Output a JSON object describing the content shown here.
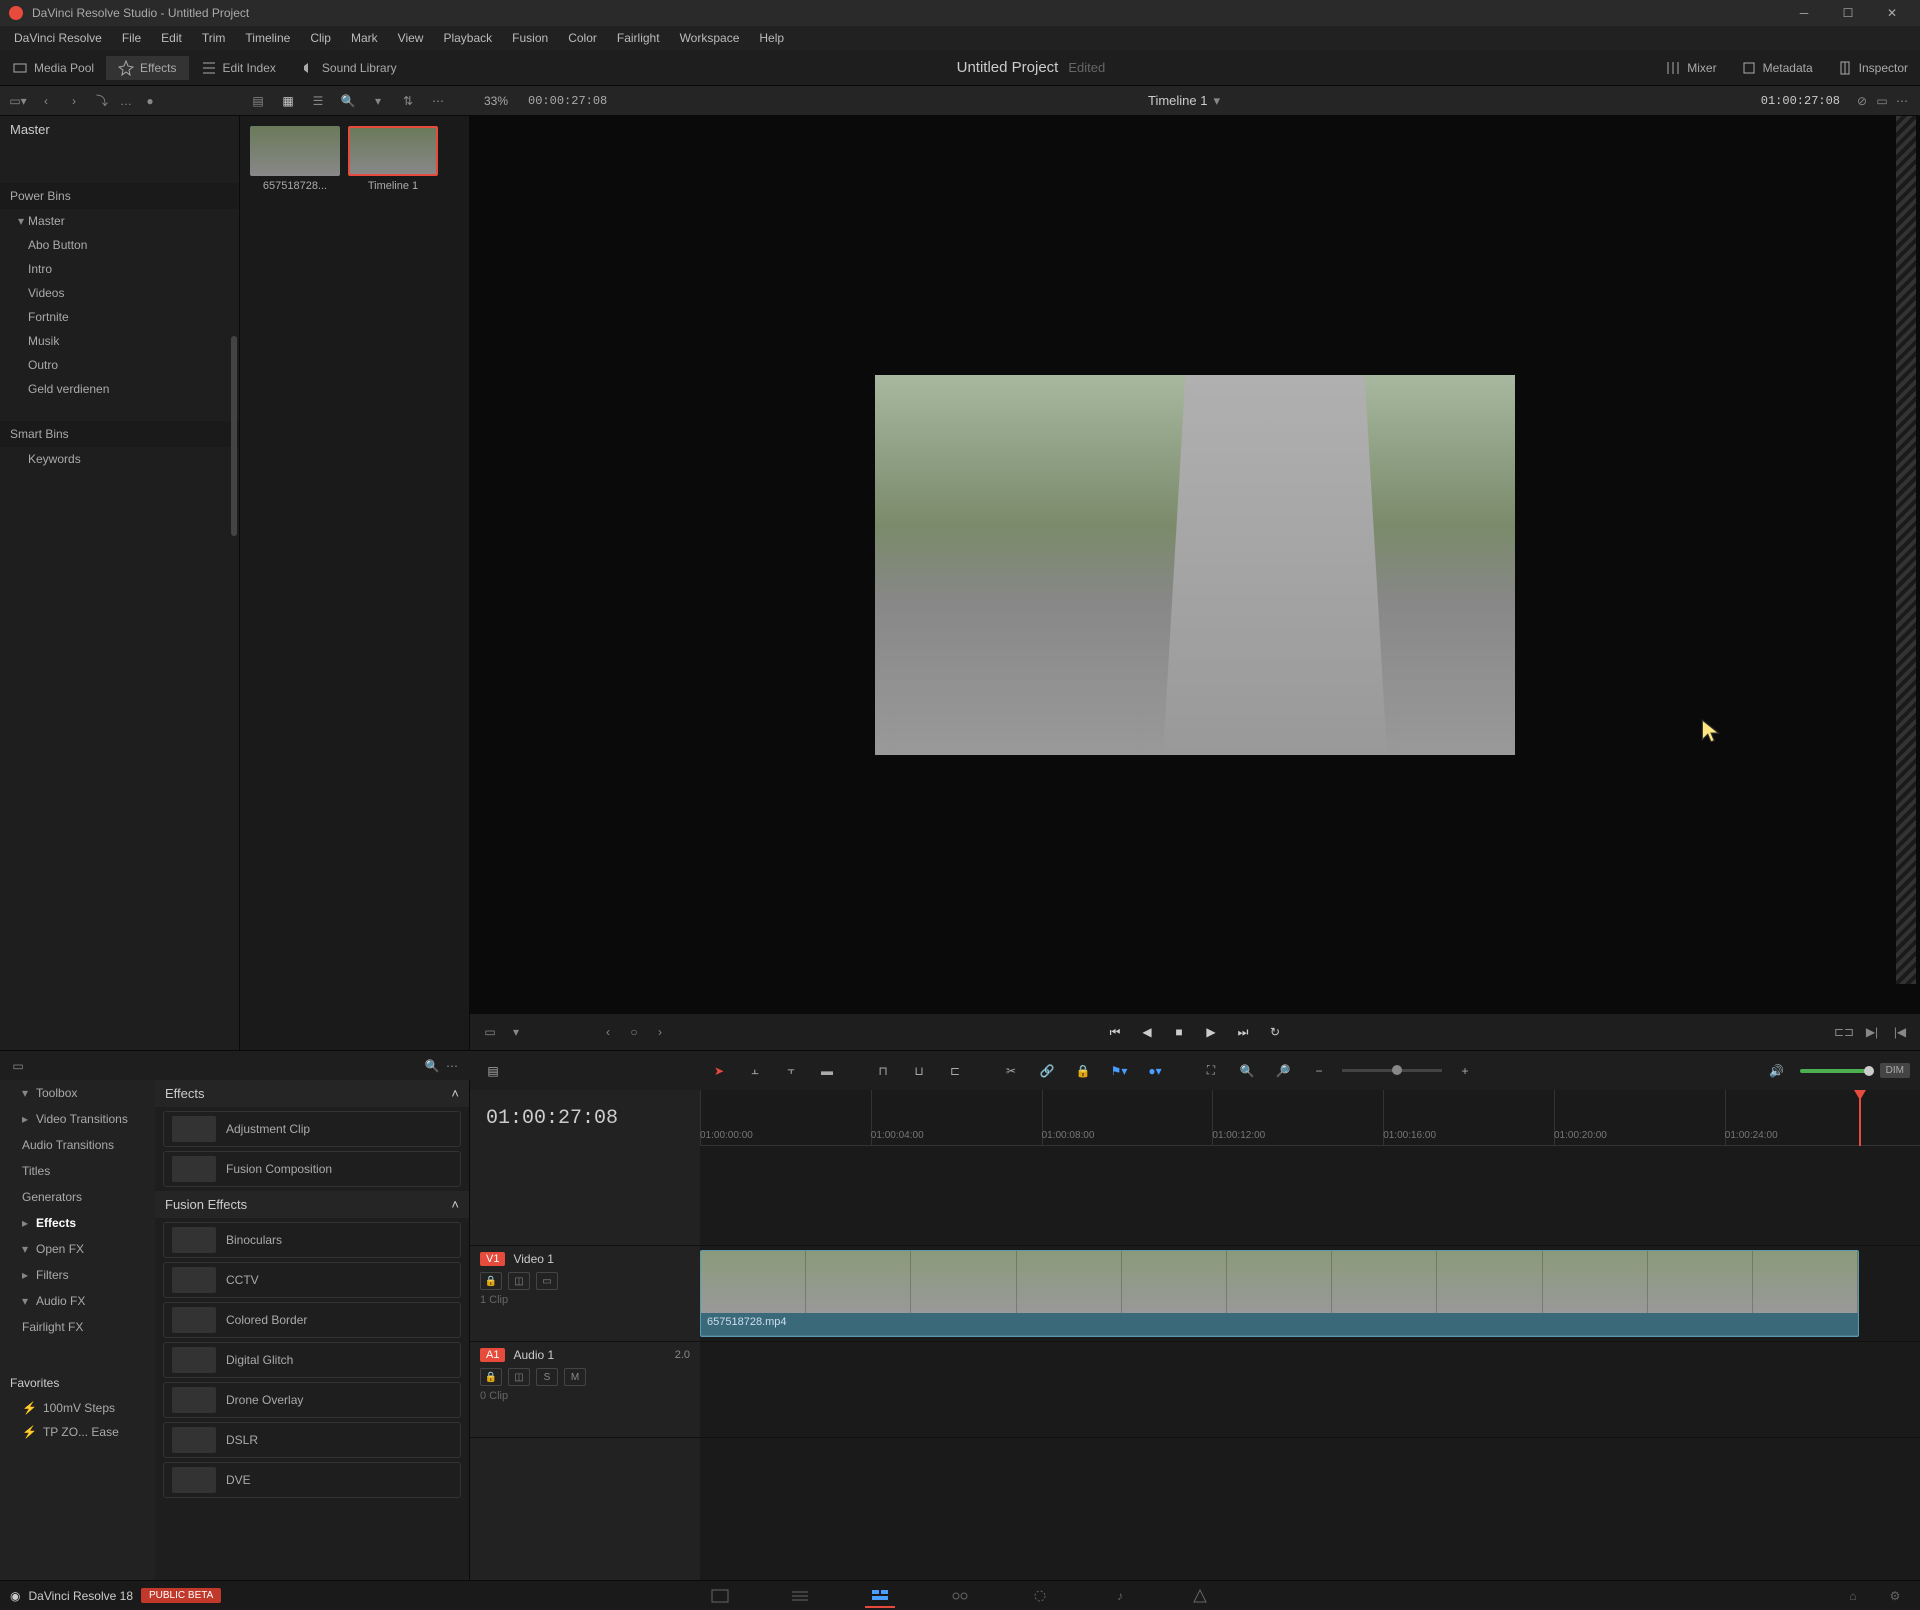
{
  "window": {
    "title": "DaVinci Resolve Studio - Untitled Project"
  },
  "menu": [
    "DaVinci Resolve",
    "File",
    "Edit",
    "Trim",
    "Timeline",
    "Clip",
    "Mark",
    "View",
    "Playback",
    "Fusion",
    "Color",
    "Fairlight",
    "Workspace",
    "Help"
  ],
  "top_toolbar": {
    "media_pool": "Media Pool",
    "effects": "Effects",
    "edit_index": "Edit Index",
    "sound_library": "Sound Library",
    "mixer": "Mixer",
    "metadata": "Metadata",
    "inspector": "Inspector"
  },
  "project": {
    "title": "Untitled Project",
    "status": "Edited"
  },
  "viewer": {
    "zoom": "33%",
    "source_tc": "00:00:27:08",
    "timeline_name": "Timeline 1",
    "record_tc": "01:00:27:08"
  },
  "bins": {
    "master": "Master",
    "power_bins": "Power Bins",
    "power_master": "Master",
    "items": [
      "Abo Button",
      "Intro",
      "Videos",
      "Fortnite",
      "Musik",
      "Outro",
      "Geld verdienen"
    ],
    "smart_bins": "Smart Bins",
    "smart_items": [
      "Keywords"
    ]
  },
  "media_thumbs": [
    {
      "name": "657518728..."
    },
    {
      "name": "Timeline 1"
    }
  ],
  "fx_tree": {
    "toolbox": "Toolbox",
    "items": [
      "Video Transitions",
      "Audio Transitions",
      "Titles",
      "Generators",
      "Effects"
    ],
    "openfx": "Open FX",
    "openfx_items": [
      "Filters"
    ],
    "audiofx": "Audio FX",
    "audiofx_items": [
      "Fairlight FX"
    ],
    "favorites": "Favorites",
    "fav_items": [
      "100mV Steps",
      "TP ZO... Ease"
    ]
  },
  "fx_list": {
    "effects_header": "Effects",
    "effects": [
      "Adjustment Clip",
      "Fusion Composition"
    ],
    "fusion_header": "Fusion Effects",
    "fusion": [
      "Binoculars",
      "CCTV",
      "Colored Border",
      "Digital Glitch",
      "Drone Overlay",
      "DSLR",
      "DVE"
    ]
  },
  "timeline": {
    "tc": "01:00:27:08",
    "ruler": [
      "01:00:00:00",
      "01:00:04:00",
      "01:00:08:00",
      "01:00:12:00",
      "01:00:16:00",
      "01:00:20:00",
      "01:00:24:00"
    ],
    "video_track": {
      "badge": "V1",
      "name": "Video 1",
      "clips": "1 Clip"
    },
    "audio_track": {
      "badge": "A1",
      "name": "Audio 1",
      "ch": "2.0",
      "clips": "0 Clip",
      "solo": "S",
      "mute": "M"
    },
    "clip_name": "657518728.mp4",
    "dim": "DIM"
  },
  "footer": {
    "version": "DaVinci Resolve 18",
    "beta": "PUBLIC BETA"
  }
}
